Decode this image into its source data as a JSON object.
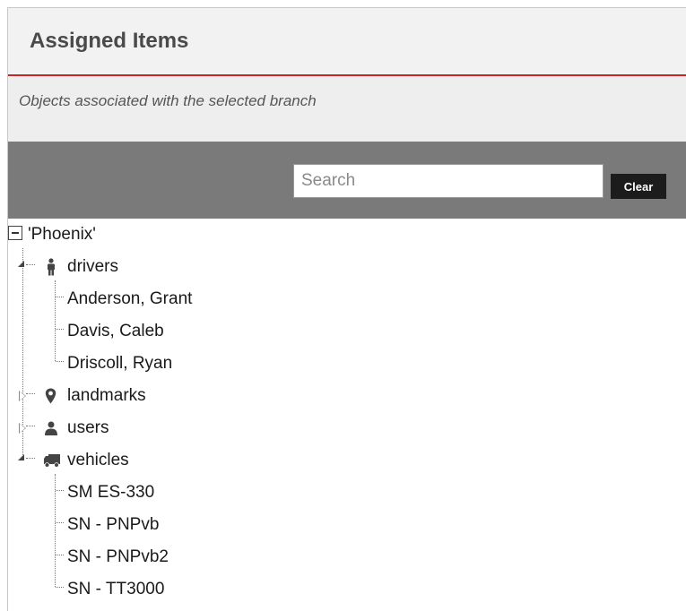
{
  "panel": {
    "title": "Assigned Items",
    "subtitle": "Objects associated with the selected branch"
  },
  "search": {
    "placeholder": "Search",
    "value": "",
    "clear_label": "Clear"
  },
  "tree": {
    "root": {
      "label": "'Phoenix'",
      "expanded": true
    },
    "groups": [
      {
        "label": "drivers",
        "icon": "person-icon",
        "expanded": true,
        "items": [
          "Anderson, Grant",
          "Davis, Caleb",
          "Driscoll, Ryan"
        ]
      },
      {
        "label": "landmarks",
        "icon": "map-pin-icon",
        "expanded": false,
        "items": []
      },
      {
        "label": "users",
        "icon": "user-icon",
        "expanded": false,
        "items": []
      },
      {
        "label": "vehicles",
        "icon": "truck-icon",
        "expanded": true,
        "items": [
          "SM ES-330",
          "SN - PNPvb",
          "SN - PNPvb2",
          "SN - TT3000"
        ]
      }
    ]
  },
  "colors": {
    "accent_rule": "#d0202a",
    "search_bar": "#7a7a7a",
    "clear_button": "#1c1c1c"
  }
}
